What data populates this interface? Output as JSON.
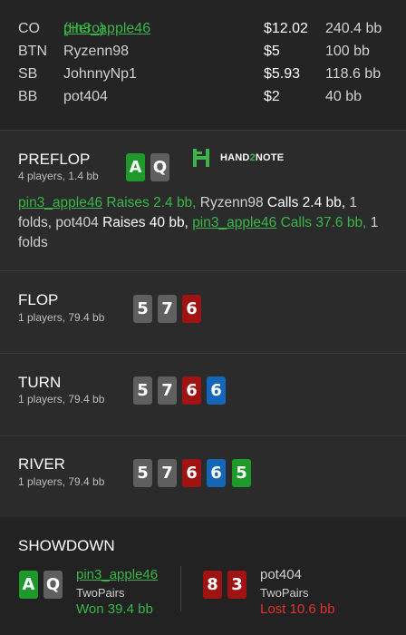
{
  "players": [
    {
      "pos": "CO",
      "name": "pin3_apple46",
      "suffix": " (Hero)",
      "stack": "$12.02",
      "bb": "240.4 bb",
      "hero": true
    },
    {
      "pos": "BTN",
      "name": "Ryzenn98",
      "suffix": "",
      "stack": "$5",
      "bb": "100 bb",
      "hero": false
    },
    {
      "pos": "SB",
      "name": "JohnnyNp1",
      "suffix": "",
      "stack": "$5.93",
      "bb": "118.6 bb",
      "hero": false
    },
    {
      "pos": "BB",
      "name": "pot404",
      "suffix": "",
      "stack": "$2",
      "bb": "40 bb",
      "hero": false
    }
  ],
  "logo": {
    "text_a": "HAND",
    "text_b": "2",
    "text_c": "NOTE"
  },
  "preflop": {
    "title": "PREFLOP",
    "sub": "4 players, 1.4 bb",
    "hero_cards": [
      {
        "rank": "A",
        "color": "green"
      },
      {
        "rank": "Q",
        "color": "gray"
      }
    ],
    "actions": {
      "a1_name": "pin3_apple46",
      "a1_verb": " Raises 2.4 bb, ",
      "a2_name": "Ryzenn98",
      "a2_verb": " Calls 2.4 bb, ",
      "a3": "1 folds, ",
      "a4_name": "pot404",
      "a4_verb": " Raises 40 bb, ",
      "a5_name": "pin3_apple46",
      "a5_verb": " Calls 37.6 bb, ",
      "a6": "1 folds"
    }
  },
  "flop": {
    "title": "FLOP",
    "sub": "1 players, 79.4 bb",
    "cards": [
      {
        "rank": "5",
        "color": "gray"
      },
      {
        "rank": "7",
        "color": "gray"
      },
      {
        "rank": "6",
        "color": "red"
      }
    ]
  },
  "turn": {
    "title": "TURN",
    "sub": "1 players, 79.4 bb",
    "cards": [
      {
        "rank": "5",
        "color": "gray"
      },
      {
        "rank": "7",
        "color": "gray"
      },
      {
        "rank": "6",
        "color": "red"
      },
      {
        "rank": "6",
        "color": "blue"
      }
    ]
  },
  "river": {
    "title": "RIVER",
    "sub": "1 players, 79.4 bb",
    "cards": [
      {
        "rank": "5",
        "color": "gray"
      },
      {
        "rank": "7",
        "color": "gray"
      },
      {
        "rank": "6",
        "color": "red"
      },
      {
        "rank": "6",
        "color": "blue"
      },
      {
        "rank": "5",
        "color": "green"
      }
    ]
  },
  "showdown": {
    "title": "SHOWDOWN",
    "left": {
      "name": "pin3_apple46",
      "hand": "TwoPairs",
      "result": "Won 39.4 bb",
      "cards": [
        {
          "rank": "A",
          "color": "green"
        },
        {
          "rank": "Q",
          "color": "gray"
        }
      ]
    },
    "right": {
      "name": "pot404",
      "hand": "TwoPairs",
      "result": "Lost 10.6 bb",
      "cards": [
        {
          "rank": "8",
          "color": "red"
        },
        {
          "rank": "3",
          "color": "red"
        }
      ]
    }
  },
  "colors": {
    "win": "#39b54a",
    "loss": "#e03030",
    "gray_card": "#5f5f5f",
    "red_card": "#a01313",
    "blue_card": "#1565b8",
    "green_card": "#1e9a2a"
  }
}
